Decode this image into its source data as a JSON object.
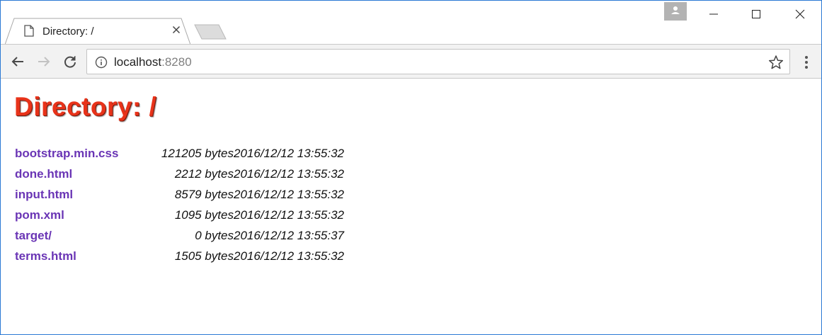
{
  "browser": {
    "tab_title": "Directory: /",
    "url_host": "localhost",
    "url_port": ":8280"
  },
  "page": {
    "heading": "Directory: /",
    "files": [
      {
        "name": "bootstrap.min.css",
        "size": "121205 bytes",
        "modified": "2016/12/12 13:55:32"
      },
      {
        "name": "done.html",
        "size": "2212 bytes",
        "modified": "2016/12/12 13:55:32"
      },
      {
        "name": "input.html",
        "size": "8579 bytes",
        "modified": "2016/12/12 13:55:32"
      },
      {
        "name": "pom.xml",
        "size": "1095 bytes",
        "modified": "2016/12/12 13:55:32"
      },
      {
        "name": "target/",
        "size": "0 bytes",
        "modified": "2016/12/12 13:55:37"
      },
      {
        "name": "terms.html",
        "size": "1505 bytes",
        "modified": "2016/12/12 13:55:32"
      }
    ]
  },
  "colors": {
    "heading": "#e8331a",
    "link": "#6a35b5",
    "window_border": "#2b79d4",
    "toolbar_bg": "#f2f2f2"
  },
  "icons": [
    "page-icon",
    "close-icon",
    "profile-icon",
    "minimize-icon",
    "maximize-icon",
    "window-close-icon",
    "back-arrow-icon",
    "forward-arrow-icon",
    "reload-icon",
    "info-icon",
    "star-icon",
    "kebab-menu-icon"
  ]
}
